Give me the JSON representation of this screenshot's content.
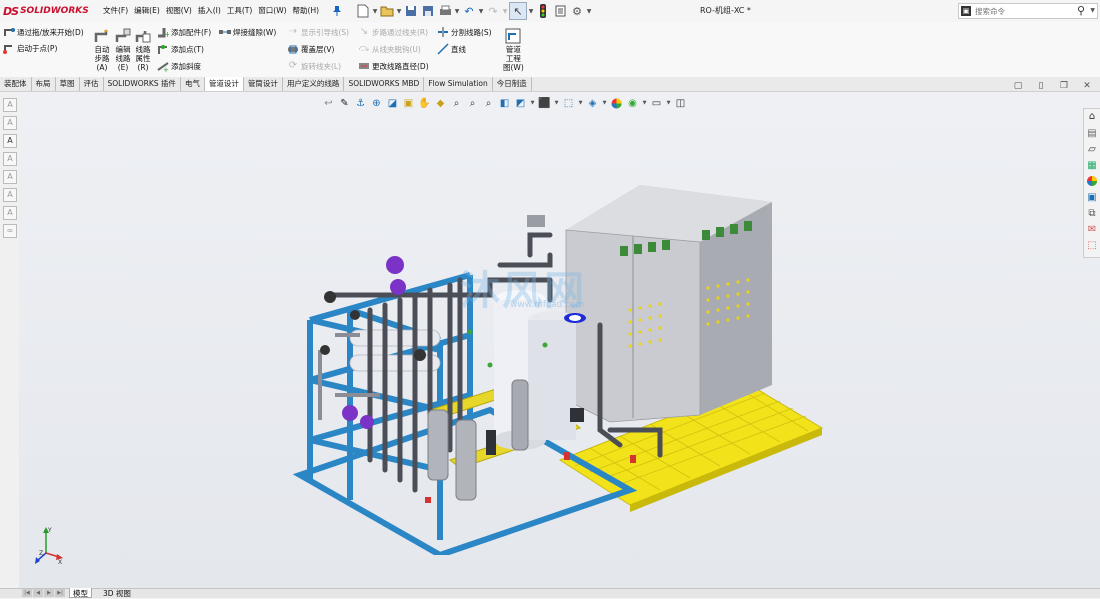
{
  "app": {
    "brand_ds": "DS",
    "brand_name": "SOLIDWORKS"
  },
  "menu": [
    "文件(F)",
    "编辑(E)",
    "视图(V)",
    "插入(I)",
    "工具(T)",
    "窗口(W)",
    "帮助(H)"
  ],
  "document_title": "RO-机组-XC *",
  "search": {
    "placeholder": "搜索命令"
  },
  "ribbon": {
    "route_drag": "通过拖/放来开始(D)",
    "start_at_point": "启动于点(P)",
    "auto_route": [
      "自动",
      "步路",
      "(A)"
    ],
    "edit_route": [
      "编辑",
      "线路",
      "(E)"
    ],
    "route_props": [
      "线路",
      "属性",
      "(R)"
    ],
    "add_fitting": "添加配件(F)",
    "weld_gap": "焊接缝隙(W)",
    "add_point": "添加点(T)",
    "add_slope": "添加斜度",
    "show_guidelines": "显示引导线(S)",
    "cover_layer": "覆盖层(V)",
    "rotate_fitting": "旋转线夹(L)",
    "step_through_clip": "步路通过线夹(R)",
    "from_clip": "从线夹脱钩(U)",
    "change_diameter": "更改线路直径(D)",
    "split_route": "分割线路(S)",
    "line": "直线",
    "pipe_drawing": [
      "管道",
      "工程",
      "图(W)"
    ]
  },
  "tabs": [
    "装配体",
    "布局",
    "草图",
    "评估",
    "SOLIDWORKS 插件",
    "电气",
    "管道设计",
    "管筒设计",
    "用户定义的线路",
    "SOLIDWORKS MBD",
    "Flow Simulation",
    "今日制造"
  ],
  "active_tab": "管道设计",
  "watermark": "沐风网",
  "watermark_sub": "www.mfcad.com",
  "bottom_tabs": [
    "模型",
    "3D 视图"
  ],
  "triad": {
    "x": "X",
    "y": "Y",
    "z": "Z"
  },
  "colors": {
    "accent": "#1f6fb3",
    "frame": "#2b86c5",
    "grating": "#f2e21a",
    "cabinet": "#c9cbd0"
  }
}
